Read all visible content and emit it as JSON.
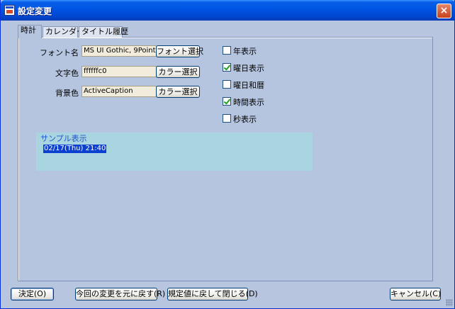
{
  "window": {
    "title": "設定変更",
    "icon": "app-settings-icon",
    "close_label": "×"
  },
  "tabs": [
    {
      "label": "時計",
      "active": true
    },
    {
      "label": "カレンダー",
      "active": false
    },
    {
      "label": "タイトル履歴",
      "active": false
    }
  ],
  "fields": {
    "font": {
      "label": "フォント名",
      "value": "MS UI Gothic, 9Point",
      "button": "フォント選択"
    },
    "text_color": {
      "label": "文字色",
      "value": "ffffffc0",
      "button": "カラー選択"
    },
    "bg_color": {
      "label": "背景色",
      "value": "ActiveCaption",
      "button": "カラー選択"
    }
  },
  "options": [
    {
      "label": "年表示",
      "checked": false
    },
    {
      "label": "曜日表示",
      "checked": true
    },
    {
      "label": "曜日和暦",
      "checked": false
    },
    {
      "label": "時間表示",
      "checked": true
    },
    {
      "label": "秒表示",
      "checked": false
    }
  ],
  "sample": {
    "title": "サンプル表示",
    "text": "02/17(Thu) 21:40"
  },
  "footer": {
    "ok": "決定(O)",
    "revert": "今回の変更を元に戻す(R)",
    "reset_close": "規定値に戻して閉じる(D)",
    "cancel": "キャンセル(C)"
  },
  "colors": {
    "title_bar": "#0054e3",
    "panel": "#b5c4df",
    "sample_bg": "#a9d5e1",
    "sample_highlight": "#0a3fcf"
  }
}
